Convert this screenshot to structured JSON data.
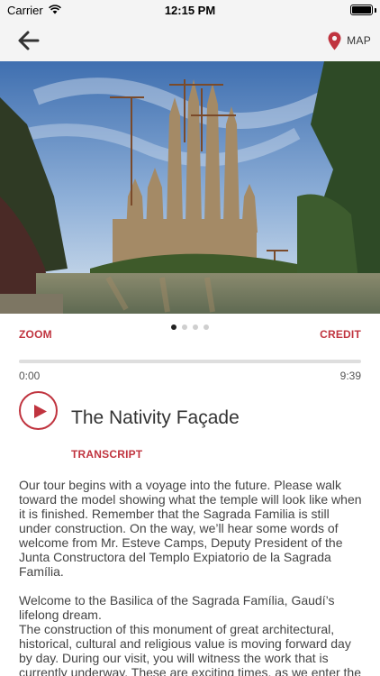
{
  "status_bar": {
    "carrier": "Carrier",
    "time": "12:15 PM",
    "battery_level": 1.0
  },
  "nav": {
    "back_icon": "arrow-left-icon",
    "map_icon": "map-pin-icon",
    "map_label": "MAP"
  },
  "gallery": {
    "image_alt": "Sagrada Família basilica with construction cranes reflected in a pond",
    "slide_count": 4,
    "active_slide": 1,
    "zoom_label": "ZOOM",
    "credit_label": "CREDIT"
  },
  "player": {
    "elapsed": "0:00",
    "duration": "9:39",
    "progress": 0,
    "play_icon": "play-icon",
    "title": "The Nativity Façade",
    "transcript_label": "TRANSCRIPT"
  },
  "transcript": {
    "paragraph_1": "Our tour begins with a voyage into the future. Please walk toward the model showing what the temple will look like when it is finished. Remember that the Sagrada Familia is still under construction. On the way, we’ll hear some words of welcome from Mr. Esteve Camps, Deputy President of the Junta Constructora del Templo Expiatorio de la Sagrada Família.",
    "paragraph_2": "Welcome to the Basilica of the Sagrada Família, Gaudí’s lifelong dream.",
    "paragraph_3": "The construction of this monument of great architectural, historical, cultural and religious value is moving forward day by day. During our visit, you will witness the work that is currently underway. These are exciting times, as we enter the final stretch. And our sights are set on the completion of"
  },
  "colors": {
    "accent": "#c0343f",
    "bar_background": "#f4f4f4"
  }
}
